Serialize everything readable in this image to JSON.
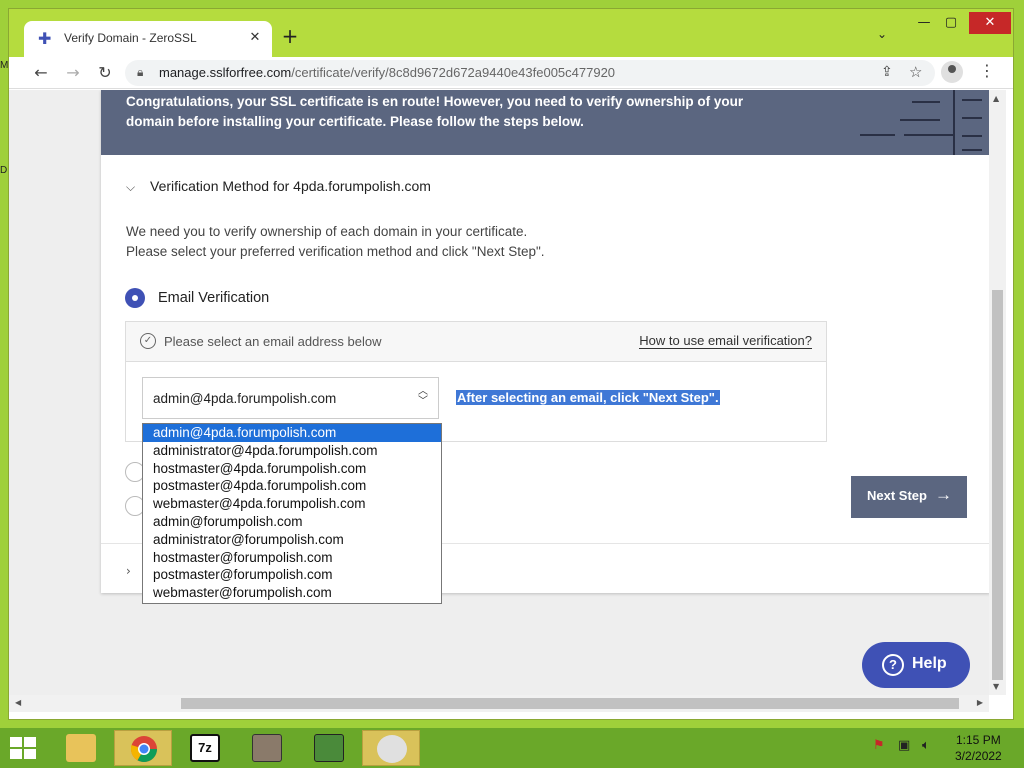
{
  "desktop": {
    "glyph_top": "M",
    "glyph_mid": "D"
  },
  "browser": {
    "tab_title": "Verify Domain - ZeroSSL",
    "url_host": "manage.sslforfree.com",
    "url_path": "/certificate/verify/8c8d9672d672a9440e43fe005c477920"
  },
  "page": {
    "banner_text": "Congratulations, your SSL certificate is en route! However, you need to verify ownership of your domain before installing your certificate. Please follow the steps below.",
    "section_title": "Verification Method for 4pda.forumpolish.com",
    "desc_line1": "We need you to verify ownership of each domain in your certificate.",
    "desc_line2": "Please select your preferred verification method and click \"Next Step\".",
    "method_label": "Email Verification",
    "email_prompt": "Please select an email address below",
    "help_link": "How to use email verification?",
    "selected_email": "admin@4pda.forumpolish.com",
    "hint": "After selecting an email, click \"Next Step\".",
    "next_button": "Next Step",
    "help_button": "Help",
    "email_options": [
      "admin@4pda.forumpolish.com",
      "administrator@4pda.forumpolish.com",
      "hostmaster@4pda.forumpolish.com",
      "postmaster@4pda.forumpolish.com",
      "webmaster@4pda.forumpolish.com",
      "admin@forumpolish.com",
      "administrator@forumpolish.com",
      "hostmaster@forumpolish.com",
      "postmaster@forumpolish.com",
      "webmaster@forumpolish.com"
    ]
  },
  "taskbar": {
    "time": "1:15 PM",
    "date": "3/2/2022"
  },
  "colors": {
    "accent": "#3f51b5",
    "banner": "#5b6680",
    "desktop": "#9fd03a",
    "selection": "#1e6fd9"
  }
}
